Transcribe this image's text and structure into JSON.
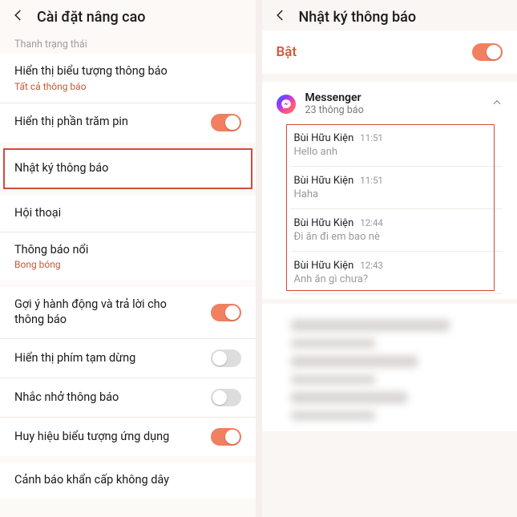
{
  "left": {
    "header_title": "Cài đặt nâng cao",
    "section_label": "Thanh trạng thái",
    "rows": {
      "show_icons": {
        "title": "Hiển thị biểu tượng thông báo",
        "sub": "Tất cả thông báo"
      },
      "battery_pct": {
        "title": "Hiển thị phần trăm pin"
      },
      "notif_log": {
        "title": "Nhật ký thông báo"
      },
      "conversation": {
        "title": "Hội thoại"
      },
      "floating": {
        "title": "Thông báo nổi",
        "sub": "Bong bóng"
      },
      "suggest_actions": {
        "title": "Gợi ý hành động và trả lời cho thông báo"
      },
      "show_pause": {
        "title": "Hiển thị phím tạm dừng"
      },
      "remind_notif": {
        "title": "Nhắc nhở thông báo"
      },
      "icon_badge": {
        "title": "Huy hiệu biểu tượng ứng dụng"
      },
      "emergency": {
        "title": "Cảnh báo khẩn cấp không dây"
      }
    }
  },
  "right": {
    "header_title": "Nhật ký thông báo",
    "master_label": "Bật",
    "app": {
      "name": "Messenger",
      "count": "23 thông báo"
    },
    "notifs": [
      {
        "sender": "Bùi Hữu Kiện",
        "time": "11:51",
        "msg": "Hello anh"
      },
      {
        "sender": "Bùi Hữu Kiện",
        "time": "11:51",
        "msg": "Haha"
      },
      {
        "sender": "Bùi Hữu Kiện",
        "time": "12:44",
        "msg": "Đi ăn đi em bao nè"
      },
      {
        "sender": "Bùi Hữu Kiện",
        "time": "12:43",
        "msg": "Anh ăn gì chưa?"
      }
    ]
  }
}
